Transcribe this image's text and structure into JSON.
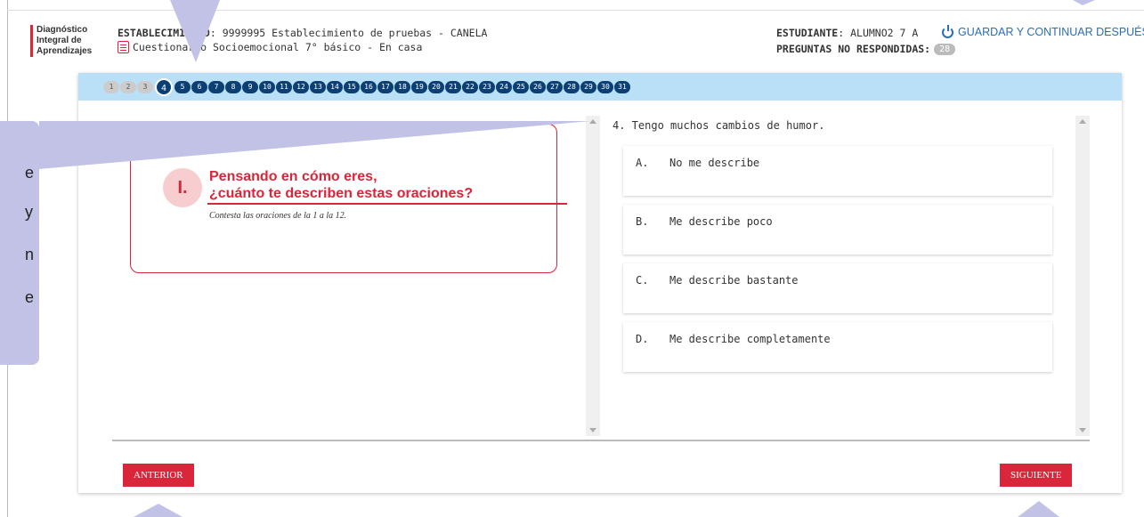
{
  "header": {
    "logo_lines": [
      "Diagnóstico",
      "Integral de",
      "Aprendizajes"
    ],
    "establishment_label": "ESTABLECIMIENTO",
    "establishment_value": ": 9999995 Establecimiento de pruebas - CANELA",
    "questionnaire": "Cuestionario Socioemocional 7° básico - En casa",
    "student_label": "ESTUDIANTE",
    "student_value": ": ALUMNO2 7 A",
    "pending_label": "PREGUNTAS NO RESPONDIDAS:",
    "pending_count": "28",
    "save_label": "GUARDAR Y CONTINUAR DESPUÉS"
  },
  "question_nav": {
    "answered": [
      "1",
      "2",
      "3"
    ],
    "current": "4",
    "pending": [
      "5",
      "6",
      "7",
      "8",
      "9",
      "10",
      "11",
      "12",
      "13",
      "14",
      "15",
      "16",
      "17",
      "18",
      "19",
      "20",
      "21",
      "22",
      "23",
      "24",
      "25",
      "26",
      "27",
      "28",
      "29",
      "30",
      "31"
    ]
  },
  "section": {
    "numeral": "I.",
    "title_line1": "Pensando en cómo eres,",
    "title_line2": "¿cuánto te describen estas oraciones?",
    "subtitle": "Contesta las oraciones de la 1 a la 12."
  },
  "question": {
    "text": "4. Tengo muchos cambios de humor.",
    "options": [
      {
        "letter": "A.",
        "text": "No me describe"
      },
      {
        "letter": "B.",
        "text": "Me describe poco"
      },
      {
        "letter": "C.",
        "text": "Me describe bastante"
      },
      {
        "letter": "D.",
        "text": "Me describe completamente"
      }
    ]
  },
  "footer": {
    "prev_label": "ANTERIOR",
    "next_label": "SIGUIENTE"
  },
  "overlay": {
    "fragments": [
      "e",
      "y",
      "n",
      "e"
    ]
  },
  "colors": {
    "accent_red": "#d9263a",
    "nav_blue": "#0c3f73",
    "nav_bar": "#b9e0f7",
    "link_blue": "#2a6eb5",
    "tutorial_overlay": "#c2c2e6"
  }
}
